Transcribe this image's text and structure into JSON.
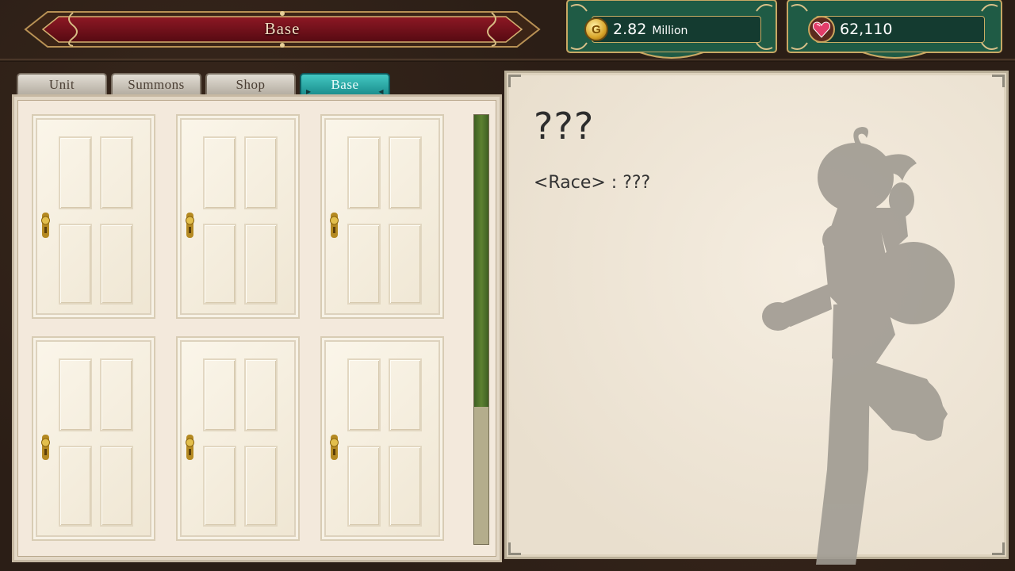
{
  "header": {
    "title": "Base"
  },
  "currency": {
    "gold": {
      "value": "2.82",
      "unit": "Million",
      "icon": "gold-coin-icon",
      "glyph": "G"
    },
    "gems": {
      "value": "62,110",
      "icon": "heart-gem-icon"
    }
  },
  "tabs": [
    {
      "label": "Unit",
      "active": false
    },
    {
      "label": "Summons",
      "active": false
    },
    {
      "label": "Shop",
      "active": false
    },
    {
      "label": "Base",
      "active": true
    }
  ],
  "rooms": [
    {
      "name": "door",
      "locked": true
    },
    {
      "name": "door",
      "locked": true
    },
    {
      "name": "door",
      "locked": true
    },
    {
      "name": "door",
      "locked": true
    },
    {
      "name": "door",
      "locked": true
    },
    {
      "name": "door",
      "locked": true
    }
  ],
  "scrollbar": {
    "position": 0,
    "visible_fraction": 0.68
  },
  "detail": {
    "name": "???",
    "race_label": "<Race>",
    "race_separator": " : ",
    "race_value": "???"
  },
  "colors": {
    "active_tab": "#2bb3b0",
    "currency_frame": "#1e5a45",
    "title_banner": "#7a0f1a",
    "scroll_thumb": "#4e7029"
  }
}
